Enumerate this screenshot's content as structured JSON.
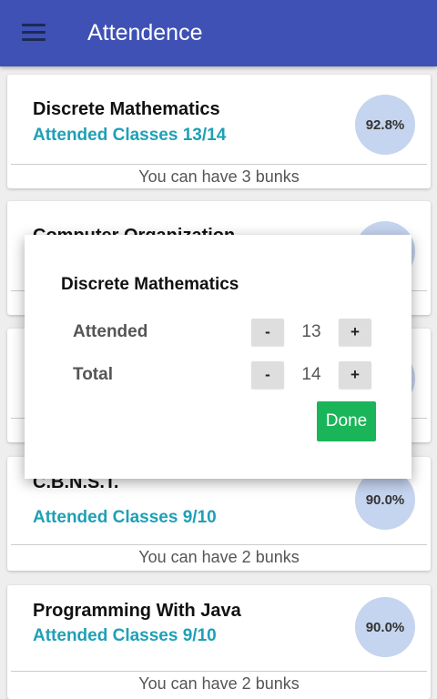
{
  "appbar": {
    "title": "Attendence",
    "menu_icon": "hamburger-menu-icon",
    "color": "#3f51b5"
  },
  "subjects": [
    {
      "name": "Discrete Mathematics",
      "attended_text": "Attended Classes 13/14",
      "percent": "92.8%",
      "bunks": "You can have 3 bunks"
    },
    {
      "name": "Computer Organization",
      "attended_text": "",
      "percent": "",
      "bunks": ""
    },
    {
      "name": "",
      "attended_text": "",
      "percent": "",
      "bunks": ""
    },
    {
      "name": "C.B.N.S.T.",
      "attended_text": "Attended Classes 9/10",
      "percent": "90.0%",
      "bunks": "You can have 2 bunks"
    },
    {
      "name": "Programming With Java",
      "attended_text": "Attended Classes 9/10",
      "percent": "90.0%",
      "bunks": "You can have 2 bunks"
    }
  ],
  "dialog": {
    "title": "Discrete Mathematics",
    "attended_label": "Attended",
    "attended_value": "13",
    "total_label": "Total",
    "total_value": "14",
    "minus_label": "-",
    "plus_label": "+",
    "done_label": "Done"
  },
  "colors": {
    "accent_text": "#1fa0b6",
    "percent_circle": "#c5d4ef",
    "done_button": "#1ab559"
  }
}
